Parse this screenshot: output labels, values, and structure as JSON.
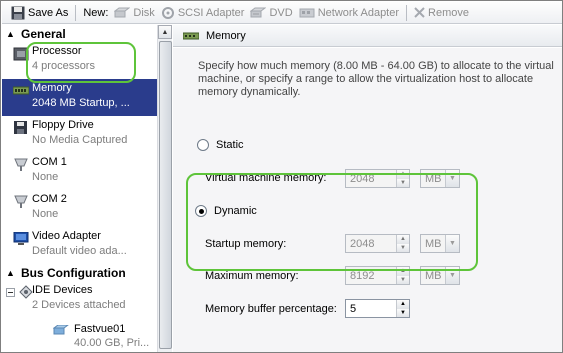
{
  "toolbar": {
    "save_as": "Save As",
    "new": "New:",
    "disk": "Disk",
    "scsi": "SCSI Adapter",
    "dvd": "DVD",
    "network": "Network Adapter",
    "remove": "Remove"
  },
  "sidebar": {
    "general": "General",
    "items": [
      {
        "title": "Processor",
        "sub": "4 processors"
      },
      {
        "title": "Memory",
        "sub": "2048 MB Startup, ..."
      },
      {
        "title": "Floppy Drive",
        "sub": "No Media Captured"
      },
      {
        "title": "COM 1",
        "sub": "None"
      },
      {
        "title": "COM 2",
        "sub": "None"
      },
      {
        "title": "Video Adapter",
        "sub": "Default video ada..."
      }
    ],
    "bus": "Bus Configuration",
    "ide": {
      "title": "IDE Devices",
      "sub": "2 Devices attached"
    },
    "disk": {
      "title": "Fastvue01",
      "sub": "40.00 GB, Pri..."
    }
  },
  "memory": {
    "header": "Memory",
    "description": "Specify how much memory (8.00 MB - 64.00 GB) to allocate to the virtual machine, or specify a range to allow the virtualization host to allocate memory dynamically.",
    "static_label": "Static",
    "vm_memory_label": "Virtual machine memory:",
    "vm_memory_value": "2048",
    "vm_memory_unit": "MB",
    "dynamic_label": "Dynamic",
    "startup_label": "Startup memory:",
    "startup_value": "2048",
    "startup_unit": "MB",
    "max_label": "Maximum memory:",
    "max_value": "8192",
    "max_unit": "MB",
    "buffer_label": "Memory buffer percentage:",
    "buffer_value": "5",
    "selected_mode": "Dynamic"
  },
  "colors": {
    "selection": "#2a3c8c",
    "highlight": "#5ec43a"
  }
}
